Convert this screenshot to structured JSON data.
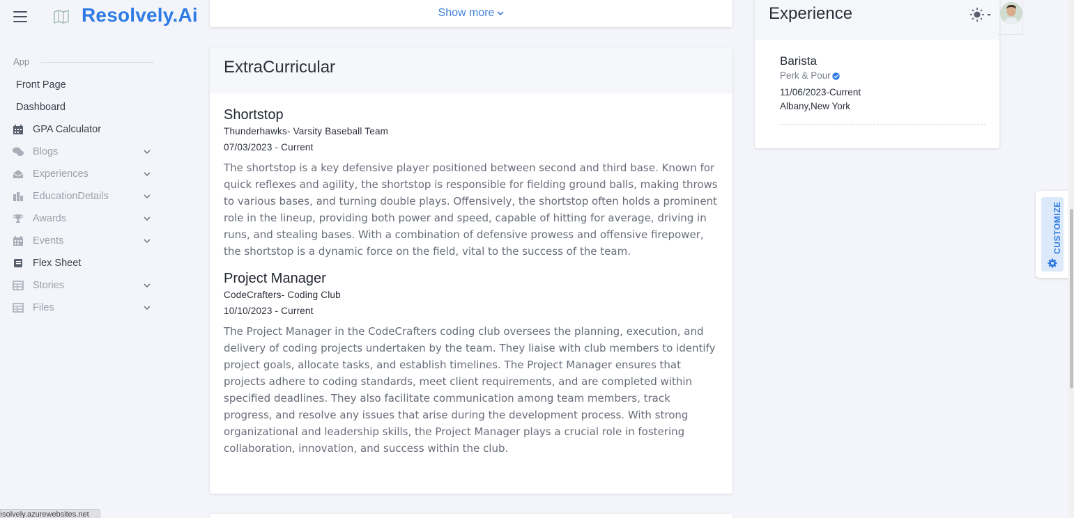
{
  "brand": {
    "name": "Resolvely.Ai"
  },
  "sidebar": {
    "section_label": "App",
    "items": [
      {
        "label": "Front Page",
        "icon": "none",
        "has_children": false
      },
      {
        "label": "Dashboard",
        "icon": "none",
        "has_children": false
      },
      {
        "label": "GPA Calculator",
        "icon": "calendar-icon",
        "has_children": false
      },
      {
        "label": "Blogs",
        "icon": "comments-icon",
        "has_children": true
      },
      {
        "label": "Experiences",
        "icon": "envelope-open-icon",
        "has_children": true
      },
      {
        "label": "EducationDetails",
        "icon": "building-icon",
        "has_children": true
      },
      {
        "label": "Awards",
        "icon": "trophy-icon",
        "has_children": true
      },
      {
        "label": "Events",
        "icon": "calendar-icon",
        "has_children": true
      },
      {
        "label": "Flex Sheet",
        "icon": "scroll-icon",
        "has_children": false
      },
      {
        "label": "Stories",
        "icon": "table-icon",
        "has_children": true
      },
      {
        "label": "Files",
        "icon": "table-icon",
        "has_children": true
      }
    ]
  },
  "top_card": {
    "show_more": "Show more"
  },
  "extracurricular": {
    "title": "ExtraCurricular",
    "entries": [
      {
        "title": "Shortstop",
        "org": "Thunderhawks- Varsity Baseball Team",
        "date": "07/03/2023 - Current",
        "description": "The shortstop is a key defensive player positioned between second and third base. Known for quick reflexes and agility, the shortstop is responsible for fielding ground balls, making throws to various bases, and turning double plays. Offensively, the shortstop often holds a prominent role in the lineup, providing both power and speed, capable of hitting for average, driving in runs, and stealing bases. With a combination of defensive prowess and offensive firepower, the shortstop is a dynamic force on the field, vital to the success of the team."
      },
      {
        "title": "Project Manager",
        "org": "CodeCrafters- Coding Club",
        "date": "10/10/2023 - Current",
        "description": "The Project Manager in the CodeCrafters coding club oversees the planning, execution, and delivery of coding projects undertaken by the team. They liaise with club members to identify project goals, allocate tasks, and establish timelines. The Project Manager ensures that projects adhere to coding standards, meet client requirements, and are completed within specified deadlines. They also facilitate communication among team members, track progress, and resolve any issues that arise during the development process. With strong organizational and leadership skills, the Project Manager plays a crucial role in fostering collaboration, innovation, and success within the club."
      }
    ]
  },
  "experience": {
    "title": "Experience",
    "role": "Barista",
    "company": "Perk & Pour",
    "date": "11/06/2023-Current",
    "location": "Albany,New York"
  },
  "customize": {
    "label": "CUSTOMIZE"
  },
  "status_url": "esolvely.azurewebsites.net",
  "colors": {
    "accent": "#2f7be5",
    "background": "#f4f5fa",
    "card": "#ffffff"
  }
}
